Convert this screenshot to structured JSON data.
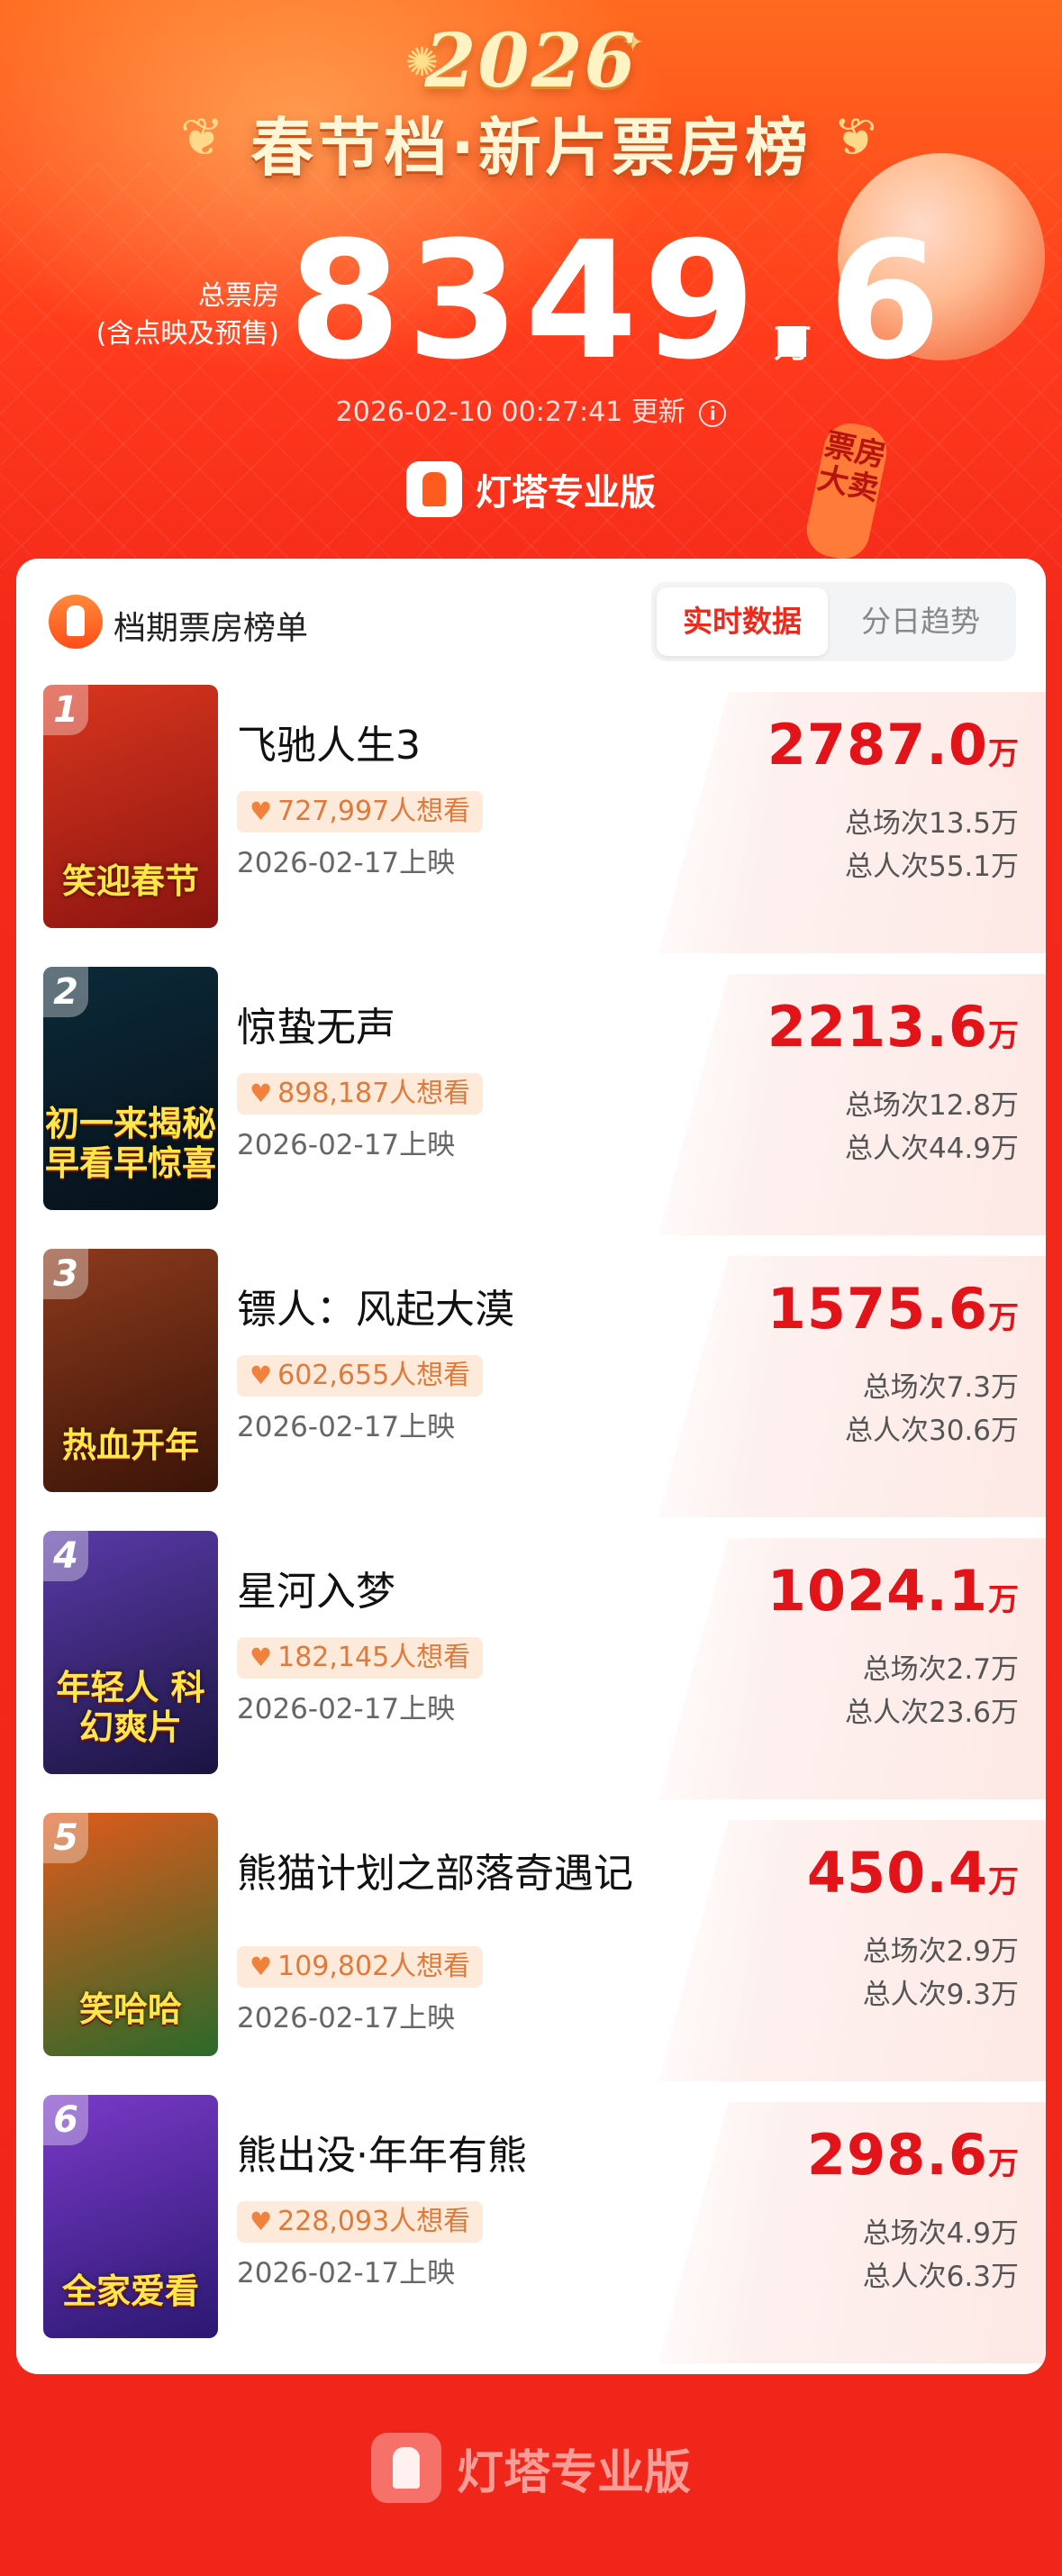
{
  "hero": {
    "year": "2026",
    "title": "春节档·新片票房榜",
    "total_label_line1": "总票房",
    "total_label_line2": "(含点映及预售)",
    "total_value": "8349.6",
    "total_unit": "万",
    "updated_time": "2026-02-10 00:27:41",
    "updated_label": "更新",
    "brand": "灯塔专业版",
    "lantern_tag": "票房大卖"
  },
  "card": {
    "title": "档期票房榜单",
    "toggle": {
      "realtime": "实时数据",
      "daily": "分日趋势",
      "active": "realtime"
    }
  },
  "movies": [
    {
      "rank": "1",
      "title": "飞驰人生3",
      "want": "727,997人想看",
      "release": "2026-02-17上映",
      "box_office": "2787.0",
      "unit": "万",
      "shows": "总场次13.5万",
      "viewers": "总人次55.1万",
      "poster_text": "笑迎春节",
      "poster_colors": [
        "#d9361e",
        "#8a1410"
      ]
    },
    {
      "rank": "2",
      "title": "惊蛰无声",
      "want": "898,187人想看",
      "release": "2026-02-17上映",
      "box_office": "2213.6",
      "unit": "万",
      "shows": "总场次12.8万",
      "viewers": "总人次44.9万",
      "poster_text": "初一来揭秘 早看早惊喜",
      "poster_colors": [
        "#0c2a3a",
        "#061018"
      ]
    },
    {
      "rank": "3",
      "title": "镖人：风起大漠",
      "want": "602,655人想看",
      "release": "2026-02-17上映",
      "box_office": "1575.6",
      "unit": "万",
      "shows": "总场次7.3万",
      "viewers": "总人次30.6万",
      "poster_text": "热血开年",
      "poster_colors": [
        "#8c3a1c",
        "#3a1408"
      ]
    },
    {
      "rank": "4",
      "title": "星河入梦",
      "want": "182,145人想看",
      "release": "2026-02-17上映",
      "box_office": "1024.1",
      "unit": "万",
      "shows": "总场次2.7万",
      "viewers": "总人次23.6万",
      "poster_text": "年轻人 科幻爽片",
      "poster_colors": [
        "#5a3aa8",
        "#1a1440"
      ]
    },
    {
      "rank": "5",
      "title": "熊猫计划之部落奇遇记",
      "want": "109,802人想看",
      "release": "2026-02-17上映",
      "box_office": "450.4",
      "unit": "万",
      "shows": "总场次2.9万",
      "viewers": "总人次9.3万",
      "poster_text": "笑哈哈",
      "poster_colors": [
        "#e05a1c",
        "#2a6a2a"
      ]
    },
    {
      "rank": "6",
      "title": "熊出没·年年有熊",
      "want": "228,093人想看",
      "release": "2026-02-17上映",
      "box_office": "298.6",
      "unit": "万",
      "shows": "总场次4.9万",
      "viewers": "总人次6.3万",
      "poster_text": "全家爱看",
      "poster_colors": [
        "#7a3ac8",
        "#2a1870"
      ]
    }
  ],
  "footer": {
    "brand": "灯塔专业版"
  },
  "colors": {
    "accent": "#e2141a",
    "want_bg": "#fdeadb",
    "want_text": "#e07a3a"
  },
  "icons": {
    "info": "info-icon",
    "heart": "heart-icon"
  }
}
